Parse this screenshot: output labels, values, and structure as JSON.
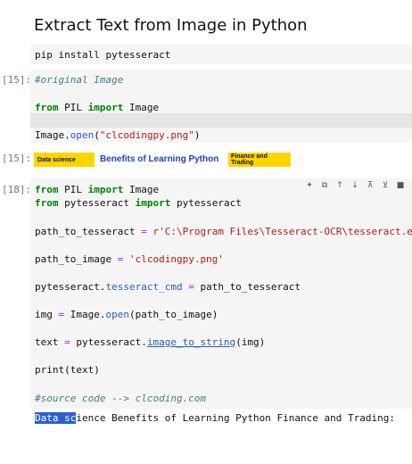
{
  "title": "Extract Text from Image in Python",
  "cells": {
    "install": {
      "prompt": "",
      "line": "pip install pytesseract"
    },
    "c15a": {
      "prompt": "[15]:",
      "comment": "#original Image",
      "line2_kw1": "from",
      "line2_mod": " PIL ",
      "line2_kw2": "import",
      "line2_name": " Image",
      "line3_obj": "Image.",
      "line3_fn": "open",
      "line3_open": "(",
      "line3_str": "\"clcodingpy.png\"",
      "line3_close": ")"
    },
    "c15b": {
      "prompt": "[15]:",
      "tag_left": "Data science",
      "banner_title": "Benefits of Learning Python",
      "tag_right": "Finance and Trading"
    },
    "c18": {
      "prompt": "[18]:",
      "l1": {
        "kw1": "from",
        "mod": " PIL ",
        "kw2": "import",
        "name": " Image"
      },
      "l2": {
        "kw1": "from",
        "mod": " pytesseract ",
        "kw2": "import",
        "name": " pytesseract"
      },
      "l3": {
        "var": "path_to_tesseract ",
        "op": "=",
        "sp": " ",
        "str": "r'C:\\Program Files\\Tesseract-OCR\\tesseract.exe'"
      },
      "l4": {
        "var": "path_to_image ",
        "op": "=",
        "sp": " ",
        "str": "'clcodingpy.png'"
      },
      "l5": {
        "obj": "pytesseract.",
        "attr": "tesseract_cmd",
        "sp": " ",
        "op": "=",
        "rest": " path_to_tesseract"
      },
      "l6": {
        "var": "img ",
        "op": "=",
        "obj": " Image.",
        "fn": "open",
        "rest": "(path_to_image)"
      },
      "l7": {
        "var": "text ",
        "op": "=",
        "obj": " pytesseract.",
        "fn": "image_to_string",
        "rest": "(img)"
      },
      "l8": {
        "fn": "print",
        "rest": "(text)"
      },
      "l9": {
        "comment": "#source code --> clcoding.com"
      },
      "output": {
        "sel": "Data sc",
        "rest": "ience Benefits of Learning Python Finance and Trading:"
      }
    }
  },
  "toolbar": [
    "sparkle-icon",
    "copy-icon",
    "move-up-icon",
    "move-down-icon",
    "insert-above-icon",
    "insert-below-icon",
    "delete-icon"
  ]
}
